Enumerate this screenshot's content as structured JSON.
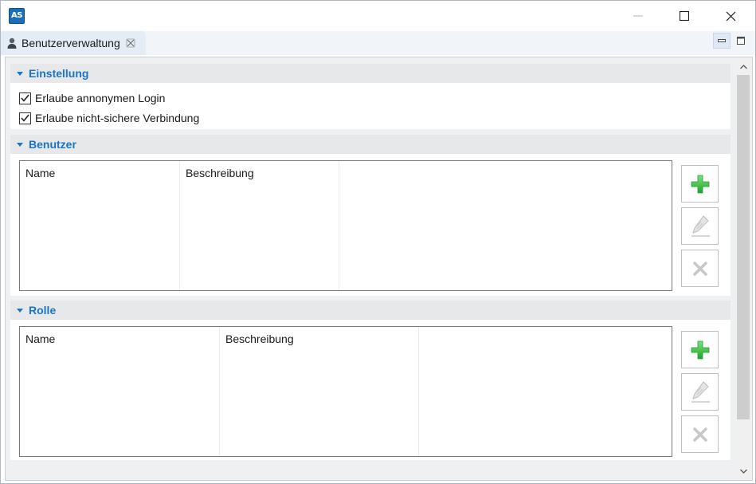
{
  "window": {
    "logo_text": "AS",
    "colors": {
      "accent": "#1a74c9",
      "add_green": "#2fbf3f",
      "disabled_gray": "#c8c8c8"
    }
  },
  "tab": {
    "label": "Benutzerverwaltung",
    "icon": "user-icon"
  },
  "sections": {
    "einstellung": {
      "title": "Einstellung",
      "options": [
        {
          "label": "Erlaube annonymen Login",
          "checked": true
        },
        {
          "label": "Erlaube nicht-sichere Verbindung",
          "checked": true
        }
      ]
    },
    "benutzer": {
      "title": "Benutzer",
      "columns": [
        "Name",
        "Beschreibung",
        ""
      ],
      "rows": [],
      "actions": {
        "add": "add-icon",
        "edit": "edit-icon",
        "delete": "delete-icon"
      }
    },
    "rolle": {
      "title": "Rolle",
      "columns": [
        "Name",
        "Beschreibung",
        ""
      ],
      "rows": [],
      "actions": {
        "add": "add-icon",
        "edit": "edit-icon",
        "delete": "delete-icon"
      }
    }
  }
}
